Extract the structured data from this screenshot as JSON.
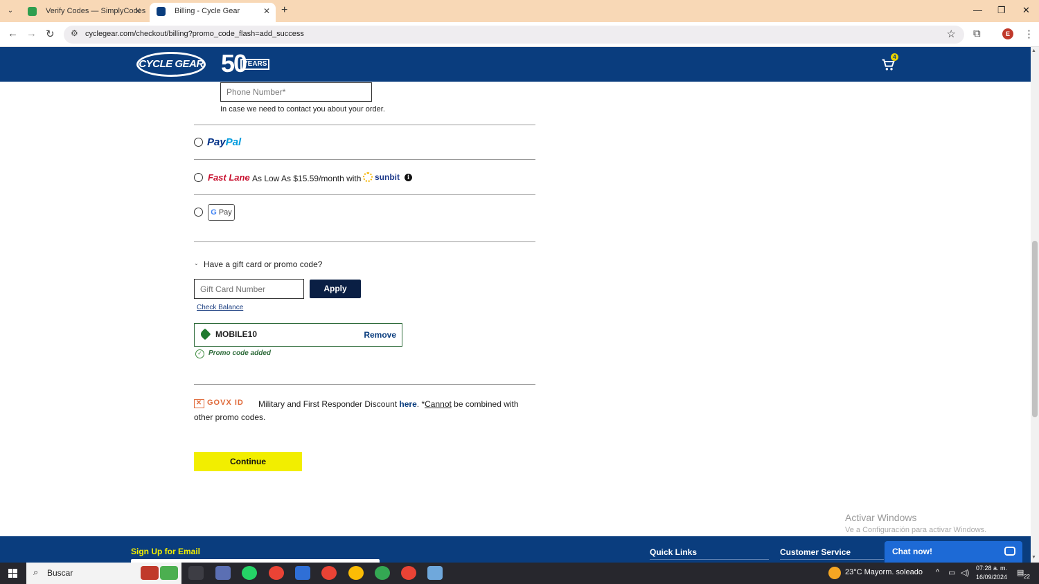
{
  "browser": {
    "tabs": [
      {
        "title": "Verify Codes — SimplyCodes",
        "active": false
      },
      {
        "title": "Billing - Cycle Gear",
        "active": true
      }
    ],
    "url": "cyclegear.com/checkout/billing?promo_code_flash=add_success",
    "profile_initial": "E"
  },
  "header": {
    "logo_text": "CYCLE GEAR",
    "anniversary_number": "50",
    "anniversary_word": "YEARS",
    "cart_count": "4"
  },
  "billing": {
    "phone_placeholder": "Phone Number*",
    "phone_help": "In case we need to contact you about your order.",
    "payment_options": {
      "paypal_a": "Pay",
      "paypal_b": "Pal",
      "fastlane_label": "Fast Lane",
      "fastlane_text": "As Low As $15.59/month with",
      "sunbit_label": "sunbit",
      "gpay_g": "G",
      "gpay_label": "Pay"
    },
    "gift_section": {
      "toggle_label": "Have a gift card or promo code?",
      "gift_card_placeholder": "Gift Card Number",
      "apply_label": "Apply",
      "check_balance_label": "Check Balance"
    },
    "applied_promo": {
      "code": "MOBILE10",
      "remove_label": "Remove",
      "status": "Promo code added"
    },
    "govx": {
      "logo_text": "GOVX ID",
      "text_before_link": "Military and First Responder Discount",
      "link_text": "here",
      "text_after_link": ". *",
      "cannot_text": "Cannot",
      "text_end": "be combined with",
      "text_line2": "other promo codes."
    },
    "continue_label": "Continue"
  },
  "watermark": {
    "line1": "Activar Windows",
    "line2": "Ve a Configuración para activar Windows."
  },
  "footer": {
    "signup_title": "Sign Up for Email",
    "quick_links_title": "Quick Links",
    "customer_service_title": "Customer Service",
    "chat_label": "Chat now!"
  },
  "taskbar": {
    "search_label": "Buscar",
    "weather": "23°C  Mayorm. soleado",
    "time": "07:28 a. m.",
    "date": "16/09/2024",
    "notifications": "22"
  },
  "colors": {
    "brand_blue": "#0a3d7e",
    "continue_yellow": "#f2ee00",
    "apply_navy": "#0a1f44",
    "footer_heading_yellow": "#f2ee00",
    "promo_green": "#2e6b3a"
  }
}
